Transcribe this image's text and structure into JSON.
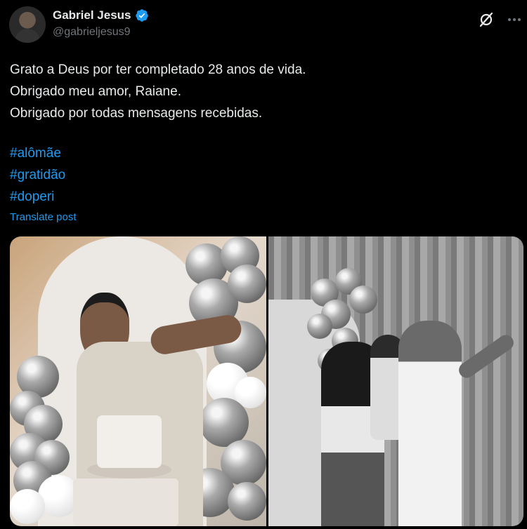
{
  "author": {
    "name": "Gabriel Jesus",
    "handle": "@gabrieljesus9"
  },
  "tweet": {
    "lines": "Grato a Deus por ter completado 28 anos de vida.\nObrigado meu amor, Raiane.\nObrigado por todas mensagens recebidas.",
    "hashtags": [
      "#alômãe",
      "#gratidão",
      "#doperi"
    ],
    "translate_label": "Translate post"
  },
  "icons": {
    "verified": "verified-badge-icon",
    "grok": "grok-icon",
    "more": "more-options-icon"
  },
  "colors": {
    "background": "#000000",
    "text": "#e7e9ea",
    "secondary": "#71767b",
    "accent": "#1d9bf0"
  }
}
